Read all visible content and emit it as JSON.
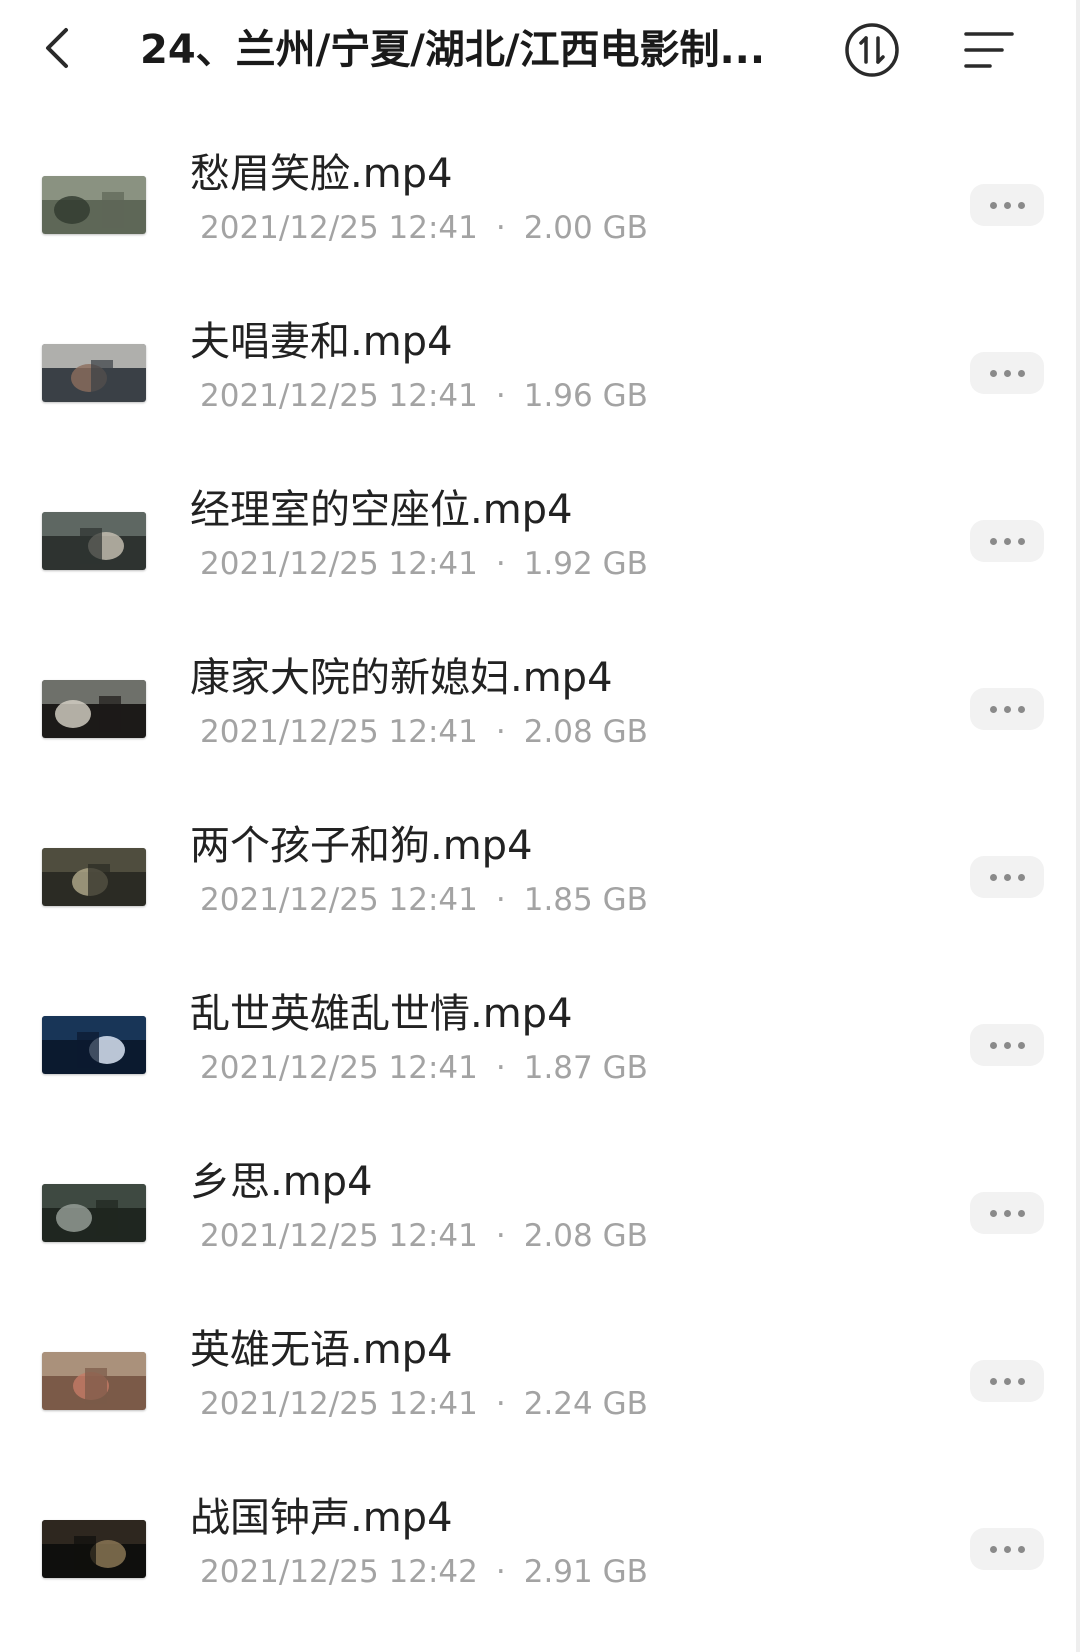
{
  "header": {
    "back_icon": "chevron-left-icon",
    "title": "24、兰州/宁夏/湖北/江西电影制...",
    "sort_icon": "sort-icon",
    "menu_icon": "menu-icon"
  },
  "files": [
    {
      "name": "愁眉笑脸.mp4",
      "date": "2021/12/25 12:41",
      "size": "2.00 GB",
      "thumb": [
        "#5e6757",
        "#9aa08f",
        "#2f3a2e"
      ]
    },
    {
      "name": "夫唱妻和.mp4",
      "date": "2021/12/25 12:41",
      "size": "1.96 GB",
      "thumb": [
        "#3a4046",
        "#d7d4cf",
        "#8c6d5c"
      ]
    },
    {
      "name": "经理室的空座位.mp4",
      "date": "2021/12/25 12:41",
      "size": "1.92 GB",
      "thumb": [
        "#2e3330",
        "#6f7a73",
        "#c9c3b5"
      ]
    },
    {
      "name": "康家大院的新媳妇.mp4",
      "date": "2021/12/25 12:41",
      "size": "2.08 GB",
      "thumb": [
        "#1c1a18",
        "#8a8d86",
        "#d9d4c9"
      ]
    },
    {
      "name": "两个孩子和狗.mp4",
      "date": "2021/12/25 12:41",
      "size": "1.85 GB",
      "thumb": [
        "#2b2b24",
        "#5c5a47",
        "#b3ab8c"
      ]
    },
    {
      "name": "乱世英雄乱世情.mp4",
      "date": "2021/12/25 12:41",
      "size": "1.87 GB",
      "thumb": [
        "#0b1a2f",
        "#1d3f66",
        "#e6f0ff"
      ]
    },
    {
      "name": "乡思.mp4",
      "date": "2021/12/25 12:41",
      "size": "2.08 GB",
      "thumb": [
        "#1f2620",
        "#4a564c",
        "#9aa39b"
      ]
    },
    {
      "name": "英雄无语.mp4",
      "date": "2021/12/25 12:41",
      "size": "2.24 GB",
      "thumb": [
        "#7b5a48",
        "#b9a48c",
        "#c57a66"
      ]
    },
    {
      "name": "战国钟声.mp4",
      "date": "2021/12/25 12:42",
      "size": "2.91 GB",
      "thumb": [
        "#0f0f0d",
        "#3a3025",
        "#8f7a57"
      ]
    }
  ],
  "more_icon": "more-horizontal-icon",
  "separator": "·"
}
